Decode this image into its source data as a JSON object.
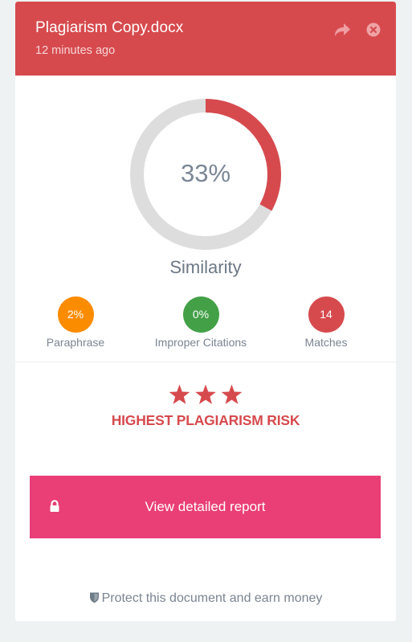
{
  "header": {
    "title": "Plagiarism Copy.docx",
    "timestamp": "12 minutes ago",
    "icons": [
      "share-icon",
      "close-circle-icon"
    ],
    "background_color": "#d64a4e"
  },
  "similarity": {
    "percent": 33,
    "label_text": "33%",
    "caption": "Similarity",
    "ring_color": "#d64a4e",
    "track_color": "#dddddd"
  },
  "stats": [
    {
      "value": "2%",
      "label": "Paraphrase",
      "color": "#fb8c00"
    },
    {
      "value": "0%",
      "label": "Improper Citations",
      "color": "#43a047"
    },
    {
      "value": "14",
      "label": "Matches",
      "color": "#d64a4e"
    }
  ],
  "risk": {
    "stars": 3,
    "star_icon": "star-icon",
    "label": "HIGHEST PLAGIARISM RISK",
    "color": "#d64a4e"
  },
  "report_button": {
    "label": "View detailed report",
    "icon": "lock-icon",
    "color": "#e93e76"
  },
  "protect_link": {
    "icon": "shield-icon",
    "label": "Protect this document and earn money"
  }
}
